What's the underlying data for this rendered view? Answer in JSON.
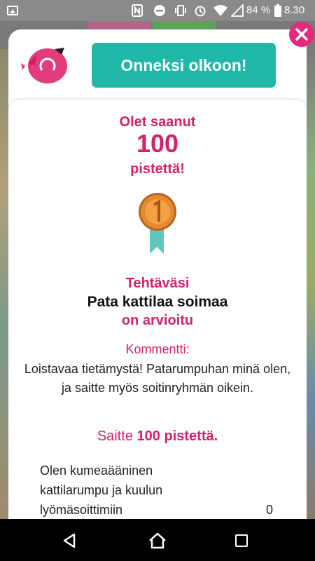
{
  "status_bar": {
    "battery": "84 %",
    "time": "8.30"
  },
  "header": {
    "congrats_label": "Onneksi olkoon!"
  },
  "score": {
    "line1": "Olet saanut",
    "points": "100",
    "line3": "pistettä!"
  },
  "task": {
    "title": "Tehtäväsi",
    "name": "Pata kattilaa soimaa",
    "status": "on arvioitu"
  },
  "comment": {
    "label": "Kommentti:",
    "text": "Loistavaa tietämystä! Patarumpuhan minä olen, ja saitte myös soitinryhmän oikein."
  },
  "result": {
    "prefix": "Saitte",
    "points_text": "100 pistettä."
  },
  "answer_rows": [
    {
      "text": "Olen kumeaääninen kattilarumpu ja kuulun lyömäsoittimiin",
      "value": "0"
    }
  ],
  "colors": {
    "accent_pink": "#d3216b",
    "teal": "#1fb7a7",
    "close_pink": "#e5297b"
  },
  "icons": {
    "bird": "pink-bird-mascot",
    "medal": "bronze-medal-number-1",
    "close": "close-x"
  }
}
